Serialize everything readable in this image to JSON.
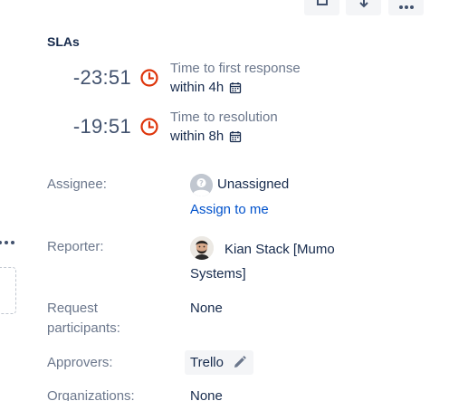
{
  "toolbar": {
    "buttons": [
      {
        "icon": "box-icon"
      },
      {
        "icon": "download-icon"
      },
      {
        "icon": "more-icon"
      }
    ]
  },
  "sla": {
    "heading": "SLAs",
    "items": [
      {
        "remaining": "-23:51",
        "name": "Time to first response",
        "goal": "within 4h",
        "status_icon": "clock-icon",
        "goal_icon": "calendar-icon"
      },
      {
        "remaining": "-19:51",
        "name": "Time to resolution",
        "goal": "within 8h",
        "status_icon": "clock-icon",
        "goal_icon": "calendar-icon"
      }
    ]
  },
  "fields": {
    "assignee": {
      "label": "Assignee:",
      "value": "Unassigned",
      "action": "Assign to me"
    },
    "reporter": {
      "label": "Reporter:",
      "value": "Kian Stack [Mumo Systems]"
    },
    "participants": {
      "label": "Request participants:",
      "value": "None"
    },
    "approvers": {
      "label": "Approvers:",
      "value": "Trello",
      "edit_icon": "pencil-icon"
    },
    "organizations": {
      "label": "Organizations:",
      "value": "None"
    }
  },
  "colors": {
    "overdue": "#de350b",
    "link": "#0052cc",
    "label": "#6b778c",
    "text": "#172b4d",
    "chip_bg": "#f4f5f7"
  }
}
